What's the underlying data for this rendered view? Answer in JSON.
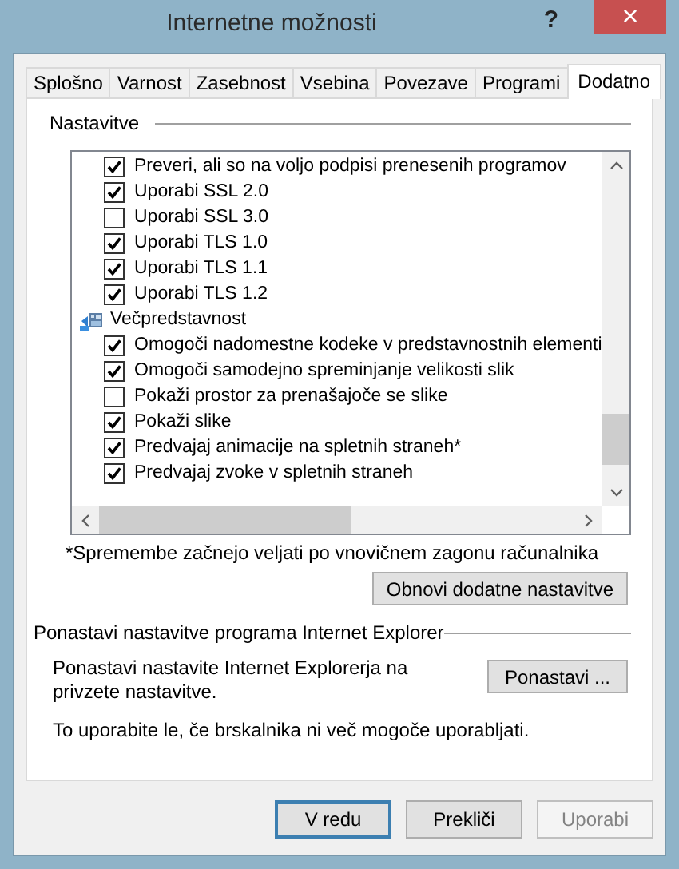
{
  "window": {
    "title": "Internetne možnosti",
    "help": "?",
    "close": "×"
  },
  "tabs": [
    {
      "label": "Splošno",
      "selected": false
    },
    {
      "label": "Varnost",
      "selected": false
    },
    {
      "label": "Zasebnost",
      "selected": false
    },
    {
      "label": "Vsebina",
      "selected": false
    },
    {
      "label": "Povezave",
      "selected": false
    },
    {
      "label": "Programi",
      "selected": false
    },
    {
      "label": "Dodatno",
      "selected": true
    }
  ],
  "settings": {
    "heading": "Nastavitve",
    "items": [
      {
        "kind": "checkbox",
        "label": "Preveri, ali so na voljo podpisi prenesenih programov",
        "checked": true
      },
      {
        "kind": "checkbox",
        "label": "Uporabi SSL 2.0",
        "checked": true
      },
      {
        "kind": "checkbox",
        "label": "Uporabi SSL 3.0",
        "checked": false
      },
      {
        "kind": "checkbox",
        "label": "Uporabi TLS 1.0",
        "checked": true
      },
      {
        "kind": "checkbox",
        "label": "Uporabi TLS 1.1",
        "checked": true
      },
      {
        "kind": "checkbox",
        "label": "Uporabi TLS 1.2",
        "checked": true
      },
      {
        "kind": "category",
        "label": "Večpredstavnost"
      },
      {
        "kind": "checkbox",
        "label": "Omogoči nadomestne kodeke v predstavnostnih elementi",
        "checked": true
      },
      {
        "kind": "checkbox",
        "label": "Omogoči samodejno spreminjanje velikosti slik",
        "checked": true
      },
      {
        "kind": "checkbox",
        "label": "Pokaži prostor za prenašajoče se slike",
        "checked": false
      },
      {
        "kind": "checkbox",
        "label": "Pokaži slike",
        "checked": true
      },
      {
        "kind": "checkbox",
        "label": "Predvajaj animacije na spletnih straneh*",
        "checked": true
      },
      {
        "kind": "checkbox",
        "label": "Predvajaj zvoke v spletnih straneh",
        "checked": true
      }
    ],
    "note": "*Spremembe začnejo veljati po vnovičnem zagonu računalnika",
    "restore_button": "Obnovi dodatne nastavitve"
  },
  "reset": {
    "heading": "Ponastavi nastavitve programa Internet Explorer",
    "description": "Ponastavi nastavite Internet Explorerja na privzete nastavitve.",
    "button": "Ponastavi ...",
    "warning": "To uporabite le, če brskalnika ni več mogoče uporabljati."
  },
  "buttons": [
    {
      "label": "V redu",
      "disabled": false,
      "default": true
    },
    {
      "label": "Prekliči",
      "disabled": false,
      "default": false
    },
    {
      "label": "Uporabi",
      "disabled": true,
      "default": false
    }
  ]
}
